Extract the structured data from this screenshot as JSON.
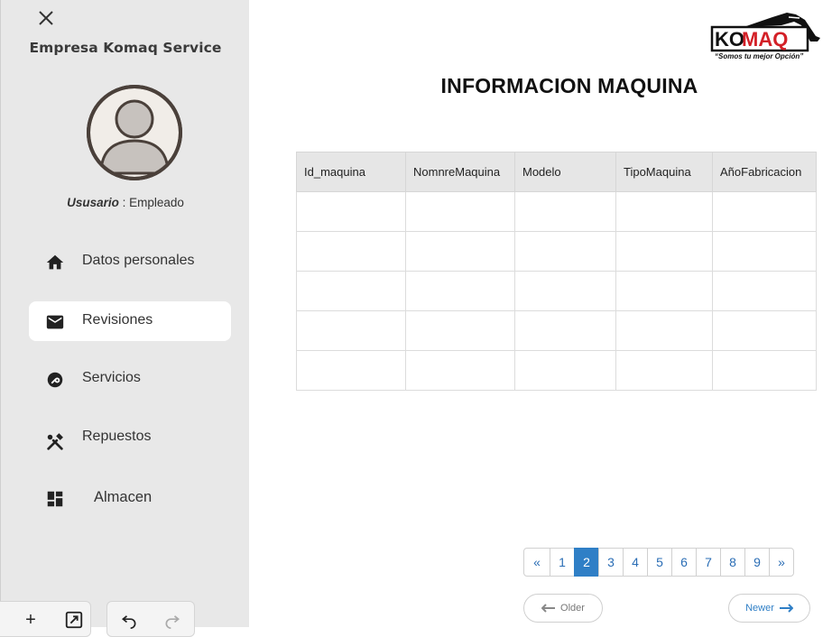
{
  "sidebar": {
    "company": "Empresa Komaq Service",
    "user_label": "Ususario",
    "user_sep": " : ",
    "user_role": "Empleado",
    "items": [
      {
        "label": "Datos personales",
        "icon": "home-icon"
      },
      {
        "label": "Revisiones",
        "icon": "mail-icon",
        "active": true
      },
      {
        "label": "Servicios",
        "icon": "wrench-icon"
      },
      {
        "label": "Repuestos",
        "icon": "tools-icon"
      },
      {
        "label": "Almacen",
        "icon": "dashboard-icon"
      }
    ],
    "toolbar": {
      "plus": "+"
    }
  },
  "logo": {
    "brand_ko": "KO",
    "brand_maq": "MAQ",
    "tagline": "“Somos tu mejor Opción”"
  },
  "main": {
    "title": "INFORMACION MAQUINA",
    "table": {
      "headers": [
        "Id_maquina",
        "NomnreMaquina",
        "Modelo",
        "TipoMaquina",
        "AñoFabricacion"
      ],
      "empty_rows": 5
    }
  },
  "pagination": {
    "prev": "«",
    "pages": [
      "1",
      "2",
      "3",
      "4",
      "5",
      "6",
      "7",
      "8",
      "9"
    ],
    "current": "2",
    "next": "»",
    "older": "Older",
    "newer": "Newer"
  },
  "colors": {
    "accent": "#2f7fc6",
    "brand_red": "#d32027",
    "sidebar_bg": "#e8e8e8"
  }
}
